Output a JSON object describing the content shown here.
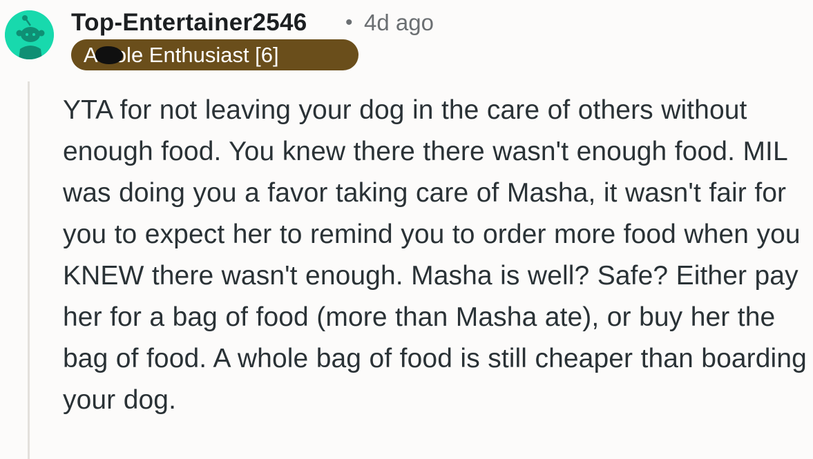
{
  "comment": {
    "author": "Top-Entertainer2546",
    "separator": "•",
    "timestamp": "4d ago",
    "flair": "A  hole Enthusiast [6]",
    "body": "YTA for not leaving your dog in the care of others without enough food. You knew there there wasn't enough food. MIL was doing you a favor taking care of Masha, it wasn't fair for you to expect her to remind you to order more food when you KNEW there wasn't enough. Masha is well? Safe? Either pay her for a bag of food (more than Masha ate), or buy her the bag of food. A whole bag of food is still cheaper than boarding your dog."
  },
  "avatar": {
    "icon": "snoo-avatar-icon",
    "background": "#18d9ad"
  },
  "colors": {
    "flair_background": "#6a4e1b",
    "thread_line": "#e3e0dc",
    "text": "#2a3236",
    "meta": "#6b6f72"
  }
}
